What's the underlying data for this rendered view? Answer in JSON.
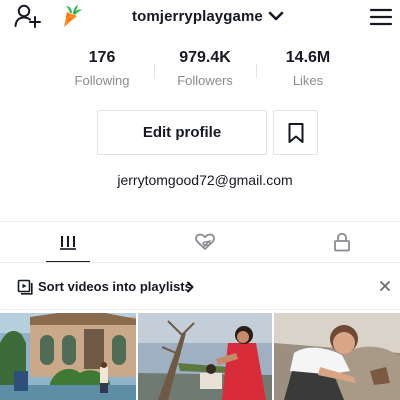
{
  "header": {
    "username": "tomjerryplaygame",
    "icons": [
      "add-user-icon",
      "carrot-icon",
      "chevron-down-icon",
      "menu-icon"
    ]
  },
  "stats": [
    {
      "value": "176",
      "label": "Following"
    },
    {
      "value": "979.4K",
      "label": "Followers"
    },
    {
      "value": "14.6M",
      "label": "Likes"
    }
  ],
  "actions": {
    "edit_profile_label": "Edit profile",
    "bookmark_icon": "bookmark-icon"
  },
  "bio": {
    "email": "jerrytomgood72@gmail.com"
  },
  "tabs": [
    {
      "icon": "grid-icon",
      "active": true
    },
    {
      "icon": "liked-hidden-icon",
      "active": false
    },
    {
      "icon": "lock-icon",
      "active": false
    }
  ],
  "playlist_banner": {
    "text": "Sort videos into playlists",
    "icons": [
      "playlist-icon",
      "chevron-right-icon",
      "close-icon"
    ]
  },
  "colors": {
    "text_primary": "#161823",
    "text_secondary": "#8a8b91",
    "divider": "#e3e3e4"
  }
}
